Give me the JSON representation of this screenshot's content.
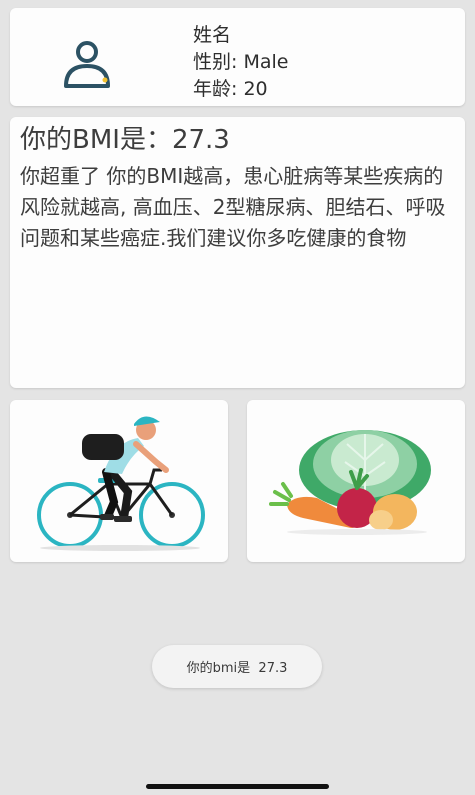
{
  "profile": {
    "name_label": "姓名",
    "gender_text": "性别: Male",
    "age_text": "年龄: 20",
    "avatar_icon": "user-icon"
  },
  "bmi": {
    "title": "你的BMI是：27.3",
    "description": "你超重了 你的BMI越高，患心脏病等某些疾病的风险就越高, 高血压、2型糖尿病、胆结石、呼吸问题和某些癌症.我们建议你多吃健康的食物"
  },
  "cards": {
    "exercise_icon": "cyclist-illustration",
    "food_icon": "vegetables-illustration"
  },
  "toast": {
    "text": "你的bmi是  27.3"
  },
  "colors": {
    "background": "#e4e4e4",
    "card": "#fdfdfd",
    "accent_teal": "#2bb5c2",
    "avatar_dark": "#2c5264"
  }
}
